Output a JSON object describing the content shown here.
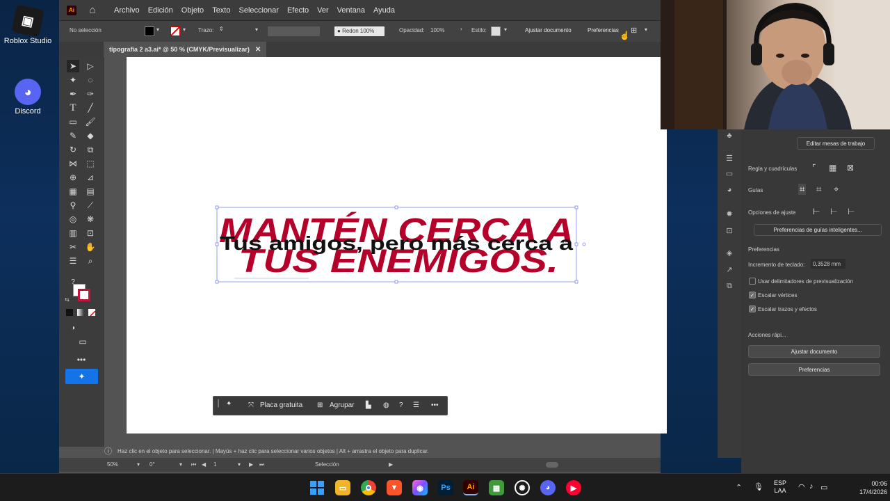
{
  "desktop": {
    "icons": [
      {
        "label": "Roblox Studio",
        "icon": "roblox-studio-icon"
      },
      {
        "label": "Discord",
        "icon": "discord-icon"
      }
    ]
  },
  "menubar": {
    "items": [
      "Archivo",
      "Edición",
      "Objeto",
      "Texto",
      "Seleccionar",
      "Efecto",
      "Ver",
      "Ventana",
      "Ayuda"
    ]
  },
  "controlbar": {
    "selection_label": "No selección",
    "stroke_label": "Trazo:",
    "round_label": "Redon",
    "round_value": "100%",
    "opacity_label": "Opacidad:",
    "opacity_value": "100%",
    "style_label": "Estilo:",
    "fit_document_label": "Ajustar documento",
    "preferences_label": "Preferencias"
  },
  "document": {
    "tab_title": "tipografia 2 a3.ai* @ 50 % (CMYK/Previsualizar)",
    "headline_line1": "MANTÉN CERCA A",
    "headline_line2": "TUS ENEMIGOS.",
    "overlay_text": "Tus amigos, pero más cerca a",
    "headline_color": "#b5002a"
  },
  "context_bar": {
    "free_plate_label": "Placa gratuita",
    "group_label": "Agrupar"
  },
  "status": {
    "hint": "Haz clic en el objeto para seleccionar.  |  Mayús + haz clic para seleccionar varios objetos  |  Alt + arrastra el objeto para duplicar.",
    "zoom": "50%",
    "rotation": "0°",
    "artboard_number": "1",
    "tool_name": "Selección"
  },
  "properties": {
    "edit_artboards_label": "Editar mesas de trabajo",
    "rulers_grids_label": "Regla y cuadrículas",
    "guides_label": "Guías",
    "snap_options_label": "Opciones de ajuste",
    "smart_guides_prefs_label": "Preferencias de guías inteligentes...",
    "preferences_heading": "Preferencias",
    "keyboard_increment_label": "Incremento de teclado:",
    "keyboard_increment_value": "0,3528 mm",
    "preview_bounds_label": "Usar delimitadores de previsualización",
    "scale_corners_label": "Escalar vértices",
    "scale_strokes_label": "Escalar trazos y efectos",
    "quick_actions_label": "Acciones rápi...",
    "fit_document_button": "Ajustar documento",
    "preferences_button": "Preferencias"
  },
  "taskbar": {
    "language_line1": "ESP",
    "language_line2": "LAA",
    "time": "00:06",
    "date": "17/4/2026",
    "apps": [
      "windows-start-icon",
      "file-explorer-icon",
      "chrome-icon",
      "brave-icon",
      "photos-icon",
      "photoshop-icon",
      "illustrator-icon",
      "minecraft-icon",
      "chatgpt-icon",
      "discord-icon",
      "youtube-music-icon"
    ],
    "ps_label": "Ps",
    "ai_label": "Ai"
  }
}
